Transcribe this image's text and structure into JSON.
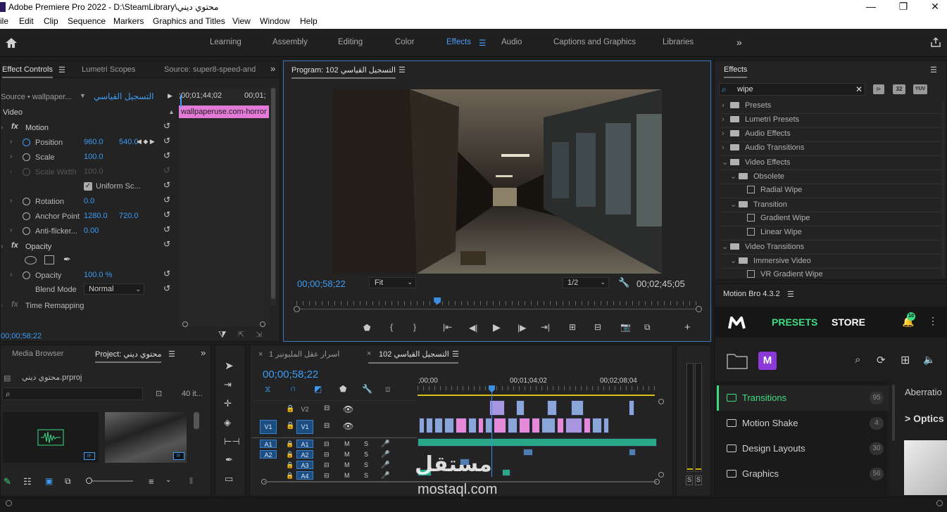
{
  "window": {
    "title": "Adobe Premiere Pro 2022 - D:\\SteamLibrary\\محتوي ديني",
    "minimize": "—",
    "maximize": "❐",
    "close": "✕"
  },
  "menu": [
    "ile",
    "Edit",
    "Clip",
    "Sequence",
    "Markers",
    "Graphics and Titles",
    "View",
    "Window",
    "Help"
  ],
  "workspaces": {
    "items": [
      "Learning",
      "Assembly",
      "Editing",
      "Color",
      "Effects",
      "Audio",
      "Captions and Graphics",
      "Libraries"
    ],
    "active": "Effects",
    "more": "»"
  },
  "effect_controls": {
    "tabs": [
      "Effect Controls",
      "Lumetri Scopes",
      "Source: super8-speed-and"
    ],
    "more": "»",
    "source_label": "Source • wallpaper...",
    "sequence_label": "التسجيل القياسي",
    "ruler_times": [
      ";00;01;44;02",
      "00;01;"
    ],
    "clip_name": "wallpaperuse.com-horror",
    "section_video": "Video",
    "motion": "Motion",
    "position": {
      "label": "Position",
      "x": "960.0",
      "y": "540.0"
    },
    "scale": {
      "label": "Scale",
      "value": "100.0"
    },
    "scale_width": {
      "label": "Scale Width",
      "value": "100.0"
    },
    "uniform_scale": "Uniform Sc...",
    "rotation": {
      "label": "Rotation",
      "value": "0.0"
    },
    "anchor": {
      "label": "Anchor Point",
      "x": "1280.0",
      "y": "720.0"
    },
    "antiflicker": {
      "label": "Anti-flicker...",
      "value": "0.00"
    },
    "opacity_section": "Opacity",
    "opacity": {
      "label": "Opacity",
      "value": "100.0 %"
    },
    "blend": {
      "label": "Blend Mode",
      "value": "Normal"
    },
    "time_remap": "Time Remapping",
    "timecode": "00;00;58;22"
  },
  "program": {
    "title": "Program: التسجيل القياسي 102",
    "timecode": "00;00;58;22",
    "fit": "Fit",
    "resolution": "1/2",
    "duration": "00;02;45;05",
    "playhead_fraction": 0.35
  },
  "effects_panel": {
    "title": "Effects",
    "search": "wipe",
    "badges": [
      "32",
      "YUV"
    ],
    "tree": [
      {
        "label": "Presets",
        "level": 0,
        "kind": "folder",
        "open": false
      },
      {
        "label": "Lumetri Presets",
        "level": 0,
        "kind": "folder",
        "open": false
      },
      {
        "label": "Audio Effects",
        "level": 0,
        "kind": "folder",
        "open": false
      },
      {
        "label": "Audio Transitions",
        "level": 0,
        "kind": "folder",
        "open": false
      },
      {
        "label": "Video Effects",
        "level": 0,
        "kind": "folder",
        "open": true
      },
      {
        "label": "Obsolete",
        "level": 1,
        "kind": "folder",
        "open": true
      },
      {
        "label": "Radial Wipe",
        "level": 2,
        "kind": "fx"
      },
      {
        "label": "Transition",
        "level": 1,
        "kind": "folder",
        "open": true
      },
      {
        "label": "Gradient Wipe",
        "level": 2,
        "kind": "fx"
      },
      {
        "label": "Linear Wipe",
        "level": 2,
        "kind": "fx"
      },
      {
        "label": "Video Transitions",
        "level": 0,
        "kind": "folder",
        "open": true
      },
      {
        "label": "Immersive Video",
        "level": 1,
        "kind": "folder",
        "open": true
      },
      {
        "label": "VR Gradient Wipe",
        "level": 2,
        "kind": "fx"
      }
    ]
  },
  "motion_bro": {
    "title": "Motion Bro 4.3.2",
    "tabs": [
      "PRESETS",
      "STORE"
    ],
    "notif_count": "10",
    "badge": "M",
    "categories": [
      {
        "name": "Transitions",
        "count": "95"
      },
      {
        "name": "Motion Shake",
        "count": "4"
      },
      {
        "name": "Design Layouts",
        "count": "30"
      },
      {
        "name": "Graphics",
        "count": "56"
      }
    ],
    "preview_title": "Aberratio",
    "preview_sub": "> Optics",
    "accent": "#3ddc84"
  },
  "project": {
    "tabs": [
      "Media Browser",
      "Project: محتوي ديني"
    ],
    "more": "»",
    "file": "محتوي ديني.prproj",
    "count": "40 it..."
  },
  "timeline": {
    "tabs": [
      "اسرار عقل المليونير 1",
      "التسجيل القياسي 102"
    ],
    "timecode": "00;00;58;22",
    "ruler": [
      ";00;00",
      "00;01;04;02",
      "00;02;08;04"
    ],
    "video_tracks": [
      "V2",
      "V1"
    ],
    "audio_tracks": [
      "A1",
      "A2",
      "A3",
      "A4"
    ],
    "src_v": "V1",
    "src_a": [
      "A1",
      "A2"
    ],
    "mute": "M",
    "solo": "S"
  },
  "meter": {
    "labels": [
      "S",
      "S"
    ]
  },
  "watermark": {
    "arabic": "مستقل",
    "latin": "mostaql.com"
  }
}
